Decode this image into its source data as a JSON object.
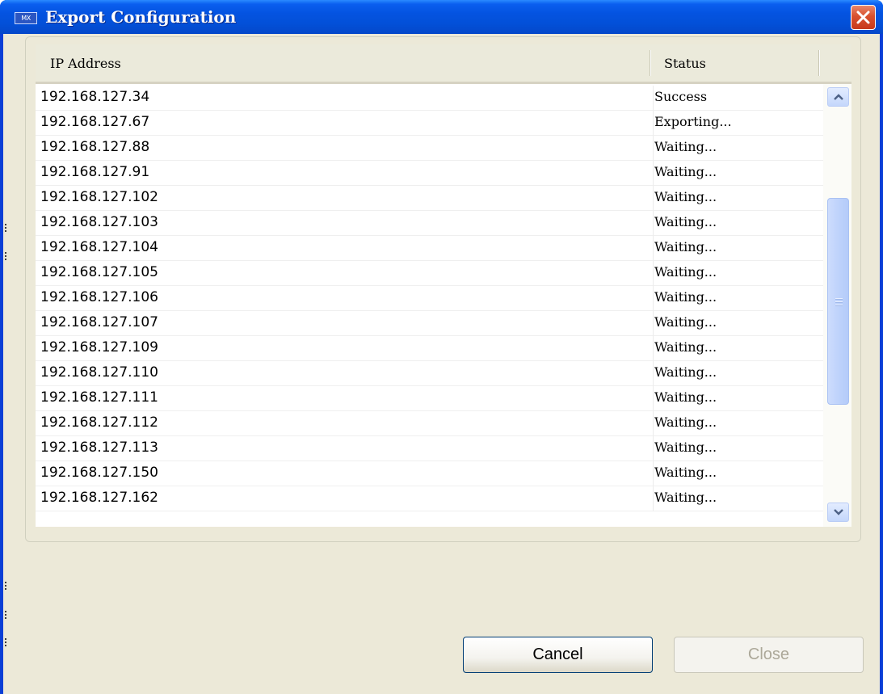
{
  "window": {
    "title": "Export Configuration",
    "app_icon_text": "MX",
    "close_icon": "close-x-icon"
  },
  "list": {
    "columns": [
      "IP Address",
      "Status"
    ],
    "rows": [
      {
        "ip": "192.168.127.34",
        "status": "Success"
      },
      {
        "ip": "192.168.127.67",
        "status": "Exporting..."
      },
      {
        "ip": "192.168.127.88",
        "status": "Waiting..."
      },
      {
        "ip": "192.168.127.91",
        "status": "Waiting..."
      },
      {
        "ip": "192.168.127.102",
        "status": "Waiting..."
      },
      {
        "ip": "192.168.127.103",
        "status": "Waiting..."
      },
      {
        "ip": "192.168.127.104",
        "status": "Waiting..."
      },
      {
        "ip": "192.168.127.105",
        "status": "Waiting..."
      },
      {
        "ip": "192.168.127.106",
        "status": "Waiting..."
      },
      {
        "ip": "192.168.127.107",
        "status": "Waiting..."
      },
      {
        "ip": "192.168.127.109",
        "status": "Waiting..."
      },
      {
        "ip": "192.168.127.110",
        "status": "Waiting..."
      },
      {
        "ip": "192.168.127.111",
        "status": "Waiting..."
      },
      {
        "ip": "192.168.127.112",
        "status": "Waiting..."
      },
      {
        "ip": "192.168.127.113",
        "status": "Waiting..."
      },
      {
        "ip": "192.168.127.150",
        "status": "Waiting..."
      },
      {
        "ip": "192.168.127.162",
        "status": "Waiting..."
      }
    ]
  },
  "buttons": {
    "cancel": "Cancel",
    "close": "Close"
  },
  "colors": {
    "title_bar": "#0453e0",
    "dialog_face": "#ece9d8",
    "close_button": "#d8502e",
    "scrollbar_thumb": "#c4d7fb"
  }
}
